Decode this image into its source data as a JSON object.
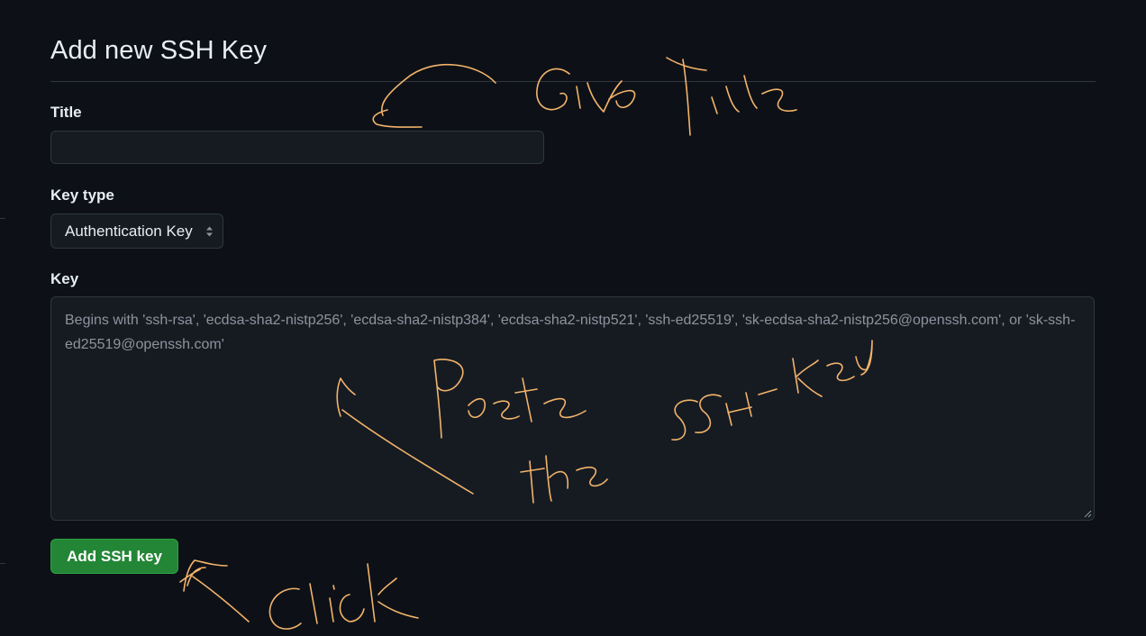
{
  "page": {
    "heading": "Add new SSH Key"
  },
  "form": {
    "title_label": "Title",
    "title_value": "",
    "key_type_label": "Key type",
    "key_type_selected": "Authentication Key",
    "key_label": "Key",
    "key_placeholder": "Begins with 'ssh-rsa', 'ecdsa-sha2-nistp256', 'ecdsa-sha2-nistp384', 'ecdsa-sha2-nistp521', 'ssh-ed25519', 'sk-ecdsa-sha2-nistp256@openssh.com', or 'sk-ssh-ed25519@openssh.com'",
    "submit_label": "Add SSH key"
  },
  "colors": {
    "background": "#0d1117",
    "input_background": "#161b22",
    "border": "#30363d",
    "button_green": "#238636",
    "annotation_ink": "#f2b36a"
  },
  "icons": {
    "select_chevron": "chevron-up-down-icon",
    "textarea_resize": "resize-grip-icon"
  }
}
